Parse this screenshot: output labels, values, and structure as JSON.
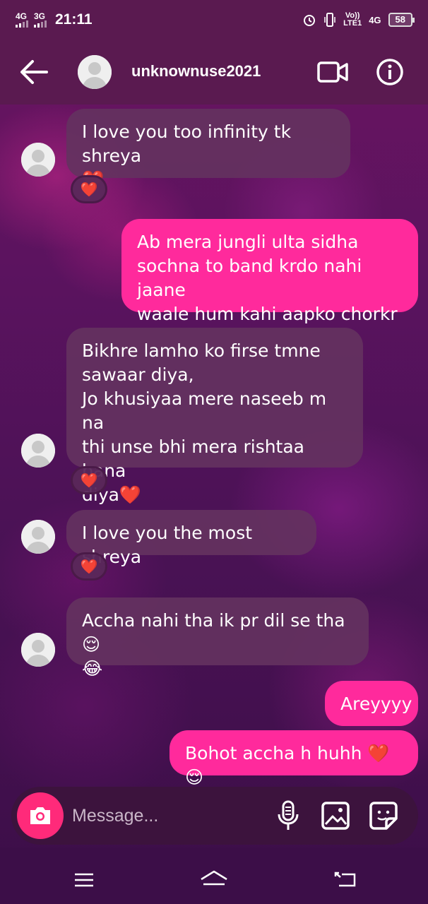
{
  "status_bar": {
    "network1": "4G",
    "network2": "3G",
    "time": "21:11",
    "volte": "Vo))",
    "lte": "LTE1",
    "network3": "4G",
    "battery": "58"
  },
  "header": {
    "username": "unknownuse2021"
  },
  "messages": [
    {
      "id": "m1",
      "text": "I love you too infinity tk shreya\n❤️",
      "reaction": "❤️"
    },
    {
      "id": "m2",
      "text": "Ab mera jungli ulta sidha\nsochna to band krdo nahi jaane\nwaale hum kahi aapko chorkr"
    },
    {
      "id": "m3",
      "text": "Bikhre lamho ko firse tmne\nsawaar diya,\nJo khusiyaa mere naseeb m na\nthi unse bhi mera rishtaa bana\ndiya❤️",
      "reaction": "❤️"
    },
    {
      "id": "m4",
      "text": "I love you the most shreya",
      "reaction": "❤️"
    },
    {
      "id": "m5",
      "text": "Accha nahi tha ik pr dil se tha😌\n😂"
    },
    {
      "id": "m6",
      "text": "Areyyyy"
    },
    {
      "id": "m7",
      "text": "Bohot accha h huhh ❤️😌"
    }
  ],
  "composer": {
    "placeholder": "Message..."
  },
  "colors": {
    "outgoing_bubble": "#ff2a9c",
    "incoming_bubble": "#64325f",
    "camera_button": "#ff2a7a",
    "header": "#5a1a50"
  }
}
